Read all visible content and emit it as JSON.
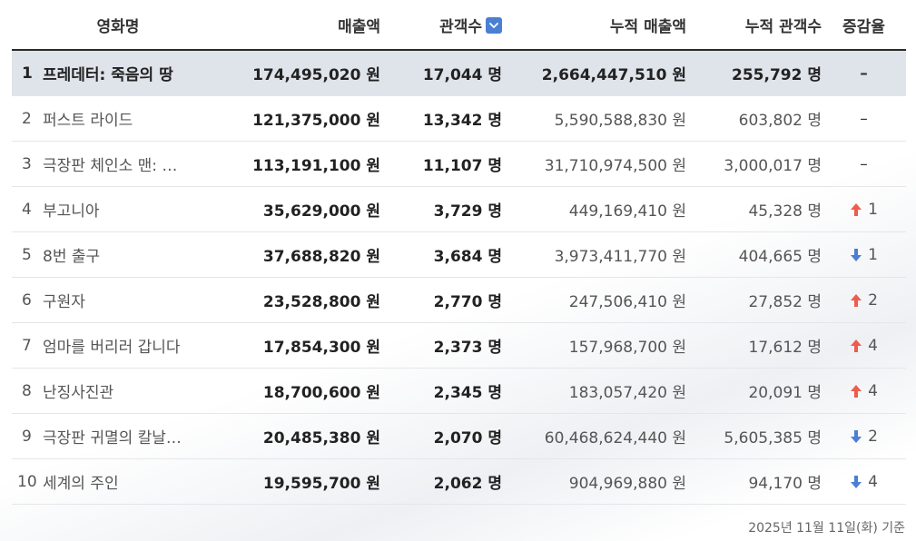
{
  "colors": {
    "up": "#ef5b4c",
    "down": "#4a7fd4",
    "highlight": "#dfe3ea",
    "sort_icon": "#4a7fd4"
  },
  "header": {
    "title": "영화명",
    "sales": "매출액",
    "audience": "관객수",
    "cum_sales": "누적 매출액",
    "cum_audience": "누적 관객수",
    "delta": "증감율",
    "sort_icon": "chevron-down-icon"
  },
  "rows": [
    {
      "rank": "1",
      "title": "프레데터: 죽음의 땅",
      "sales": "174,495,020 원",
      "audience": "17,044 명",
      "cum_sales": "2,664,447,510 원",
      "cum_audience": "255,792 명",
      "delta_dir": "none",
      "delta": "–"
    },
    {
      "rank": "2",
      "title": "퍼스트 라이드",
      "sales": "121,375,000 원",
      "audience": "13,342 명",
      "cum_sales": "5,590,588,830 원",
      "cum_audience": "603,802 명",
      "delta_dir": "none",
      "delta": "–"
    },
    {
      "rank": "3",
      "title": "극장판 체인소 맨: …",
      "sales": "113,191,100 원",
      "audience": "11,107 명",
      "cum_sales": "31,710,974,500 원",
      "cum_audience": "3,000,017 명",
      "delta_dir": "none",
      "delta": "–"
    },
    {
      "rank": "4",
      "title": "부고니아",
      "sales": "35,629,000 원",
      "audience": "3,729 명",
      "cum_sales": "449,169,410 원",
      "cum_audience": "45,328 명",
      "delta_dir": "up",
      "delta": "1"
    },
    {
      "rank": "5",
      "title": "8번 출구",
      "sales": "37,688,820 원",
      "audience": "3,684 명",
      "cum_sales": "3,973,411,770 원",
      "cum_audience": "404,665 명",
      "delta_dir": "down",
      "delta": "1"
    },
    {
      "rank": "6",
      "title": "구원자",
      "sales": "23,528,800 원",
      "audience": "2,770 명",
      "cum_sales": "247,506,410 원",
      "cum_audience": "27,852 명",
      "delta_dir": "up",
      "delta": "2"
    },
    {
      "rank": "7",
      "title": "엄마를 버리러 갑니다",
      "sales": "17,854,300 원",
      "audience": "2,373 명",
      "cum_sales": "157,968,700 원",
      "cum_audience": "17,612 명",
      "delta_dir": "up",
      "delta": "4"
    },
    {
      "rank": "8",
      "title": "난징사진관",
      "sales": "18,700,600 원",
      "audience": "2,345 명",
      "cum_sales": "183,057,420 원",
      "cum_audience": "20,091 명",
      "delta_dir": "up",
      "delta": "4"
    },
    {
      "rank": "9",
      "title": "극장판 귀멸의 칼날…",
      "sales": "20,485,380 원",
      "audience": "2,070 명",
      "cum_sales": "60,468,624,440 원",
      "cum_audience": "5,605,385 명",
      "delta_dir": "down",
      "delta": "2"
    },
    {
      "rank": "10",
      "title": "세계의 주인",
      "sales": "19,595,700 원",
      "audience": "2,062 명",
      "cum_sales": "904,969,880 원",
      "cum_audience": "94,170 명",
      "delta_dir": "down",
      "delta": "4"
    }
  ],
  "footer": "2025년 11월 11일(화) 기준"
}
